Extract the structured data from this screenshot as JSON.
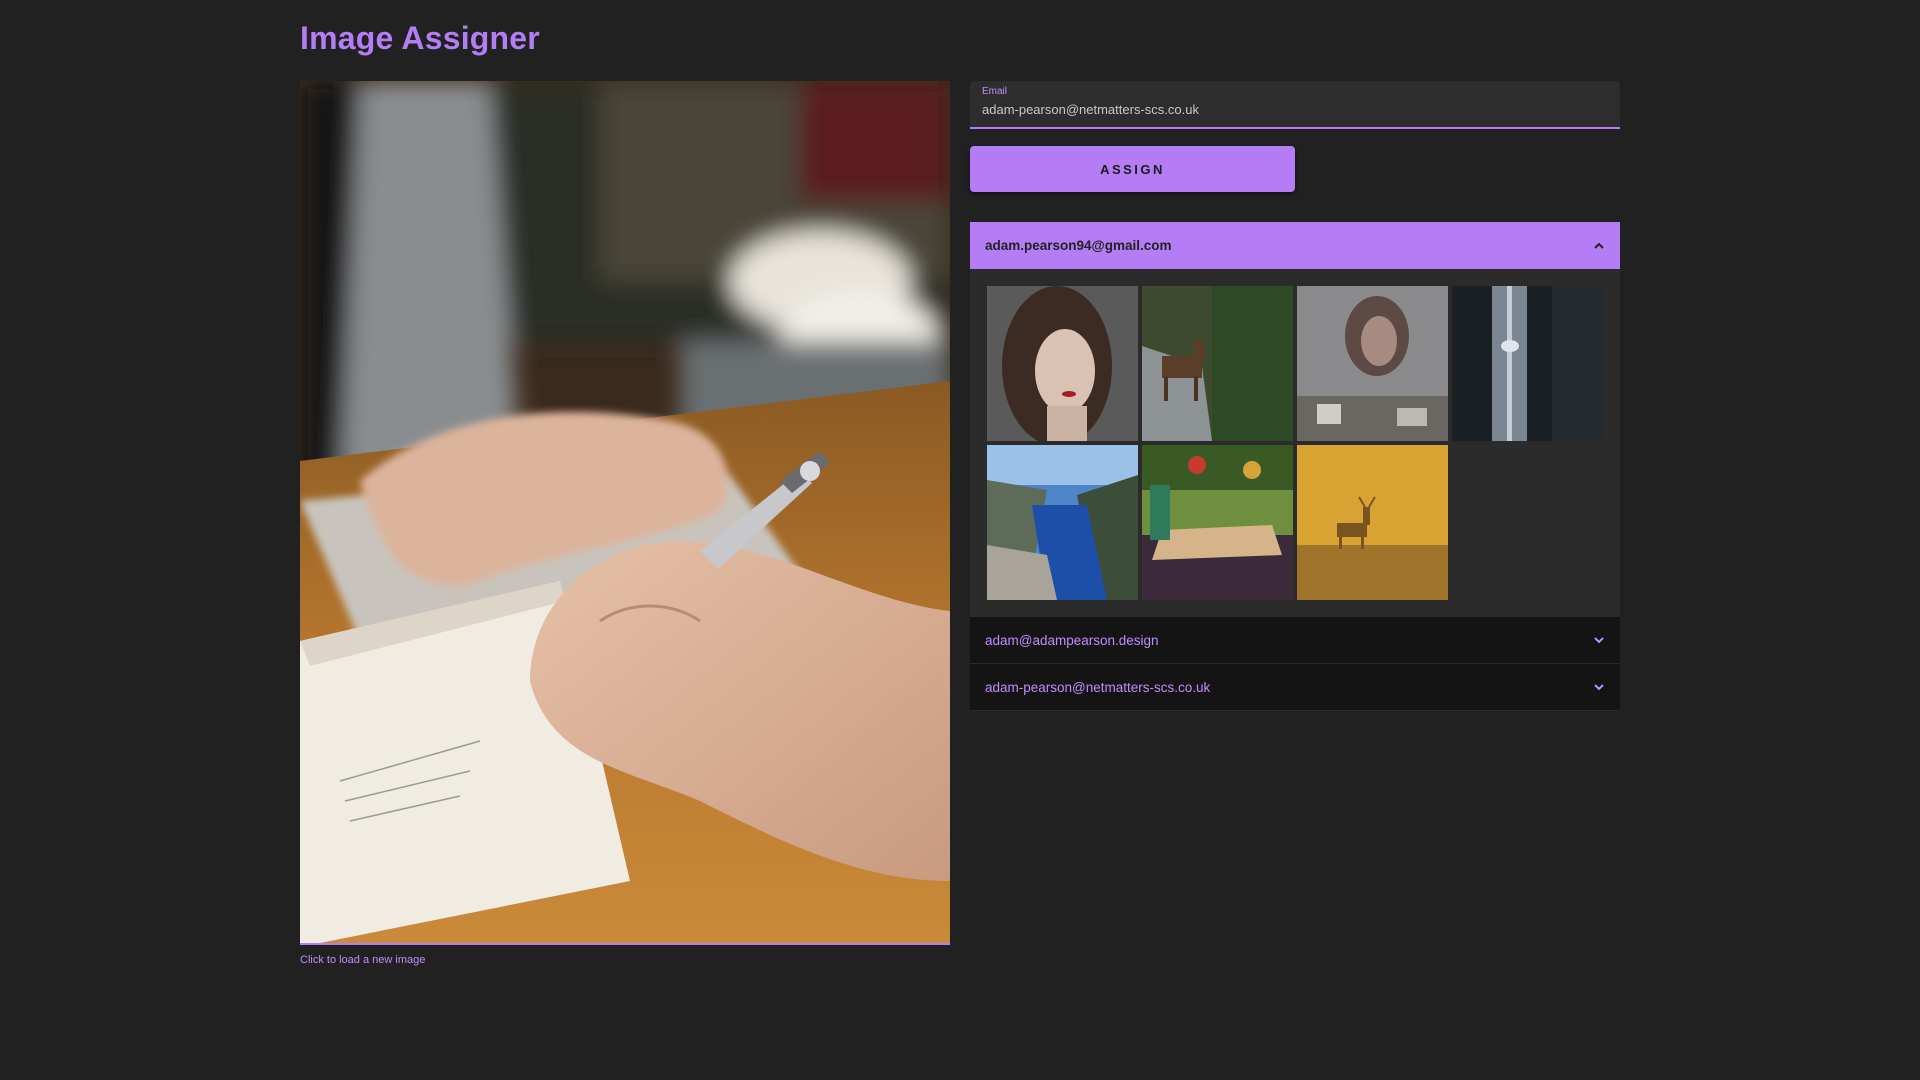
{
  "app": {
    "title": "Image Assigner"
  },
  "main_image": {
    "hint": "Click to load a new image"
  },
  "email_field": {
    "label": "Email",
    "value": "adam-pearson@netmatters-scs.co.uk"
  },
  "assign_button": {
    "label": "ASSIGN"
  },
  "accordion": {
    "panels": [
      {
        "email": "adam.pearson94@gmail.com",
        "expanded": true,
        "thumbnails": [
          "portrait-woman-red-lips",
          "deer-in-forest-stream",
          "woman-reflection-window",
          "cn-tower-between-buildings",
          "fjord-cliff-landscape",
          "cafe-table-plants",
          "deer-golden-fog"
        ]
      },
      {
        "email": "adam@adampearson.design",
        "expanded": false
      },
      {
        "email": "adam-pearson@netmatters-scs.co.uk",
        "expanded": false
      }
    ]
  },
  "colors": {
    "accent": "#b57df5",
    "background": "#212121",
    "panel": "#2b2b2b"
  },
  "icons": {
    "expanded": "chevron-up-icon",
    "collapsed": "chevron-down-icon"
  }
}
